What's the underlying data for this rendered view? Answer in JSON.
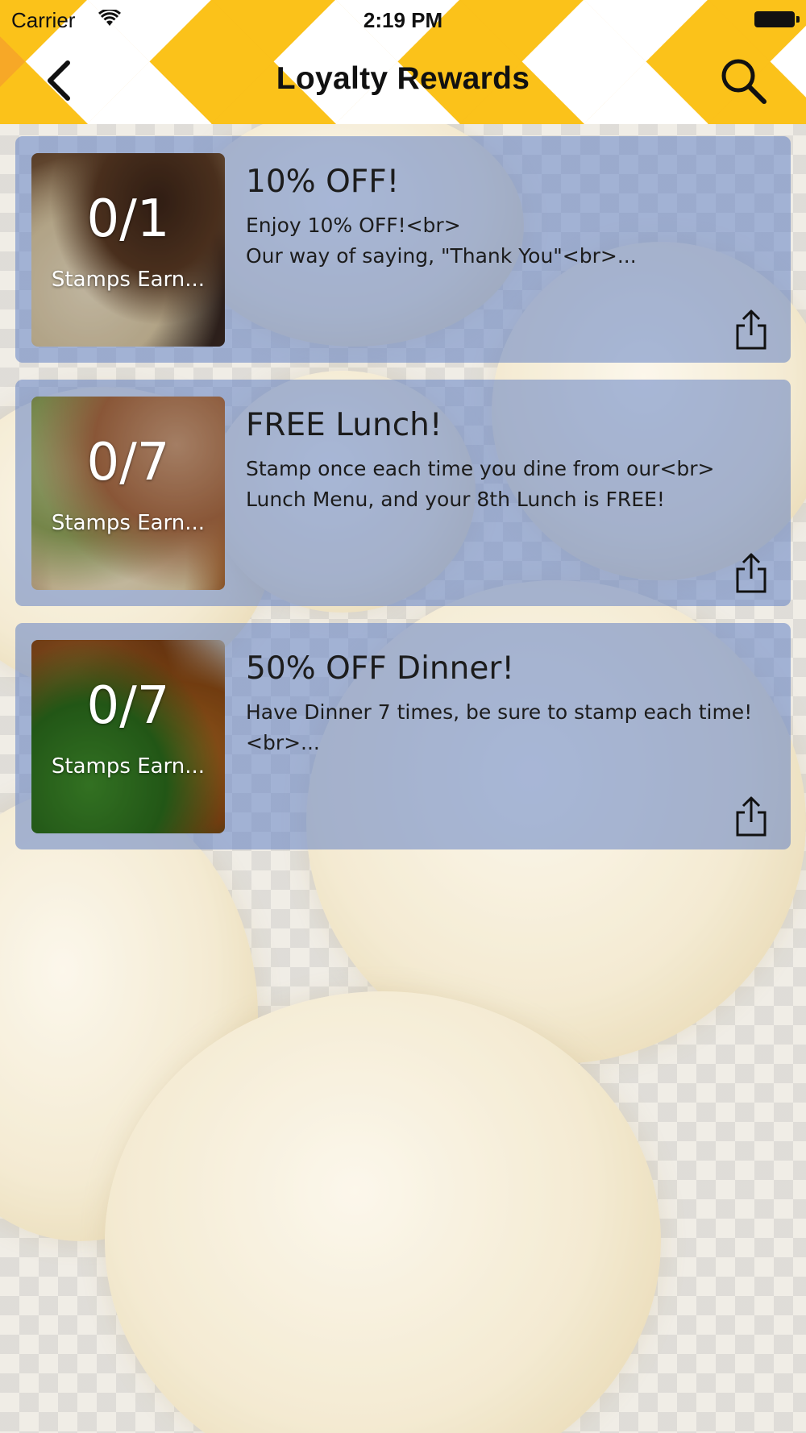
{
  "status_bar": {
    "carrier": "Carrier",
    "time": "2:19 PM"
  },
  "nav": {
    "title": "Loyalty Rewards",
    "back_icon": "chevron-left-icon",
    "search_icon": "search-icon"
  },
  "colors": {
    "harlequin_yellow": "#fbc21a",
    "harlequin_orange": "#f7a827",
    "harlequin_white": "#ffffff",
    "card_tint": "#6282c4"
  },
  "rewards": [
    {
      "stamps": "0/1",
      "stamps_label": "Stamps Earn...",
      "title": "10% OFF!",
      "description": "Enjoy 10% OFF!<br>\nOur way of saying, \"Thank You\"<br>...",
      "share_icon": "share-icon"
    },
    {
      "stamps": "0/7",
      "stamps_label": "Stamps Earn...",
      "title": "FREE Lunch!",
      "description": "Stamp once each time you dine from our<br>\nLunch Menu, and your 8th Lunch is FREE!",
      "share_icon": "share-icon"
    },
    {
      "stamps": "0/7",
      "stamps_label": "Stamps Earn...",
      "title": "50% OFF Dinner!",
      "description": "Have Dinner 7 times, be sure to stamp each time!\n<br>...",
      "share_icon": "share-icon"
    }
  ]
}
